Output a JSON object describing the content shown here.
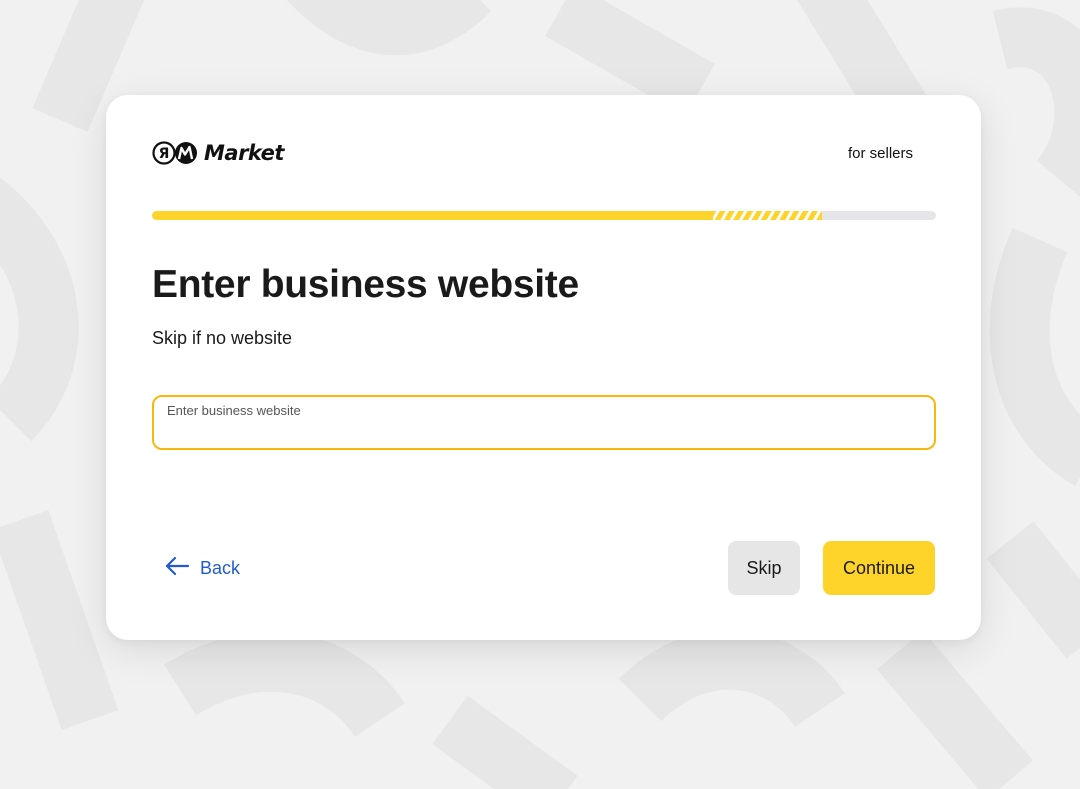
{
  "header": {
    "logo_text": "Market",
    "logo_mark_letter": "Я",
    "for_sellers": "for sellers"
  },
  "progress": {
    "fraction": 0.855,
    "segment_fraction": 0.14
  },
  "main": {
    "title": "Enter business website",
    "subtitle": "Skip if no website"
  },
  "website_input": {
    "label": "Enter business website",
    "value": ""
  },
  "footer": {
    "back_label": "Back",
    "skip_label": "Skip",
    "continue_label": "Continue"
  },
  "icons": {
    "back": "arrow-left-icon",
    "logo": "yandex-market-logo"
  },
  "colors": {
    "accent_yellow": "#fed42b",
    "input_border": "#f5b90c",
    "link_blue": "#2259d6",
    "skip_button_bg": "#e6e6e6",
    "background": "#f1f1f1",
    "card_background": "#ffffff"
  }
}
